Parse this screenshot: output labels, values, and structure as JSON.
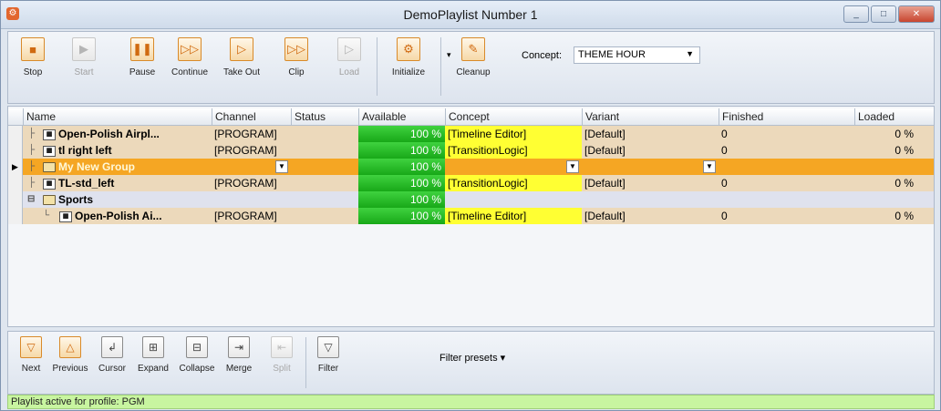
{
  "window": {
    "title": "DemoPlaylist Number 1",
    "app_icon": "app-logo-icon",
    "controls": [
      "_",
      "□",
      "✕"
    ]
  },
  "toolbar": {
    "buttons": [
      {
        "label": "Stop",
        "icon": "stop-icon",
        "glyph": "■",
        "enabled": true
      },
      {
        "label": "Start",
        "icon": "play-icon",
        "glyph": "▶",
        "enabled": false
      },
      {
        "label": "Pause",
        "icon": "pause-icon",
        "glyph": "❚❚",
        "enabled": true
      },
      {
        "label": "Continue",
        "icon": "continue-icon",
        "glyph": "▷▷",
        "enabled": true
      },
      {
        "label": "Take Out",
        "icon": "take-out-icon",
        "glyph": "▷",
        "enabled": true
      },
      {
        "label": "Clip",
        "icon": "clip-icon",
        "glyph": "▷▷",
        "enabled": true
      },
      {
        "label": "Load",
        "icon": "load-icon",
        "glyph": "▷",
        "enabled": false
      },
      {
        "label": "Initialize",
        "icon": "initialize-icon",
        "glyph": "⚙",
        "enabled": true
      },
      {
        "label": "Cleanup",
        "icon": "cleanup-icon",
        "glyph": "✎",
        "enabled": true
      }
    ],
    "concept_label": "Concept:",
    "concept_value": "THEME HOUR"
  },
  "grid": {
    "columns": [
      "Name",
      "Channel",
      "Status",
      "Available",
      "Concept",
      "Variant",
      "Finished",
      "Loaded"
    ],
    "rows": [
      {
        "name": "Open-Polish Airpl...",
        "channel": "[PROGRAM]",
        "status": "",
        "available": "100 %",
        "concept": "[Timeline Editor]",
        "variant": "[Default]",
        "finished": "0",
        "loaded": "0 %",
        "style": "tan"
      },
      {
        "name": "tl right left",
        "channel": "[PROGRAM]",
        "status": "",
        "available": "100 %",
        "concept": "[TransitionLogic]",
        "variant": "[Default]",
        "finished": "0",
        "loaded": "0 %",
        "style": "tan"
      },
      {
        "name": "My New Group",
        "channel": "",
        "status": "",
        "available": "100 %",
        "concept": "",
        "variant": "",
        "finished": "",
        "loaded": "",
        "style": "orange"
      },
      {
        "name": "TL-std_left",
        "channel": "[PROGRAM]",
        "status": "",
        "available": "100 %",
        "concept": "[TransitionLogic]",
        "variant": "[Default]",
        "finished": "0",
        "loaded": "0 %",
        "style": "tan"
      },
      {
        "name": "Sports",
        "channel": "",
        "status": "",
        "available": "100 %",
        "concept": "",
        "variant": "",
        "finished": "",
        "loaded": "",
        "style": "lav"
      },
      {
        "name": "Open-Polish Ai...",
        "channel": "[PROGRAM]",
        "status": "",
        "available": "100 %",
        "concept": "[Timeline Editor]",
        "variant": "[Default]",
        "finished": "0",
        "loaded": "0 %",
        "style": "tan"
      }
    ]
  },
  "bottom_toolbar": {
    "buttons": [
      {
        "label": "Next",
        "icon": "next-icon",
        "glyph": "▽",
        "enabled": true
      },
      {
        "label": "Previous",
        "icon": "previous-icon",
        "glyph": "△",
        "enabled": true
      },
      {
        "label": "Cursor",
        "icon": "cursor-icon",
        "glyph": "↲",
        "enabled": true
      },
      {
        "label": "Expand",
        "icon": "expand-icon",
        "glyph": "⊞",
        "enabled": true
      },
      {
        "label": "Collapse",
        "icon": "collapse-icon",
        "glyph": "⊟",
        "enabled": true
      },
      {
        "label": "Merge",
        "icon": "merge-icon",
        "glyph": "⇥",
        "enabled": true
      },
      {
        "label": "Split",
        "icon": "split-icon",
        "glyph": "⇤",
        "enabled": false
      },
      {
        "label": "Filter",
        "icon": "filter-icon",
        "glyph": "▽",
        "enabled": true
      }
    ],
    "filter_presets": "Filter presets ▾"
  },
  "status": {
    "text": "Playlist active for profile: PGM"
  },
  "colors": {
    "accent_orange": "#f5a623",
    "row_tan": "#ecd9bb",
    "available_green": "#18a818",
    "concept_yellow": "#ffff33",
    "status_green": "#c8f5a0"
  }
}
